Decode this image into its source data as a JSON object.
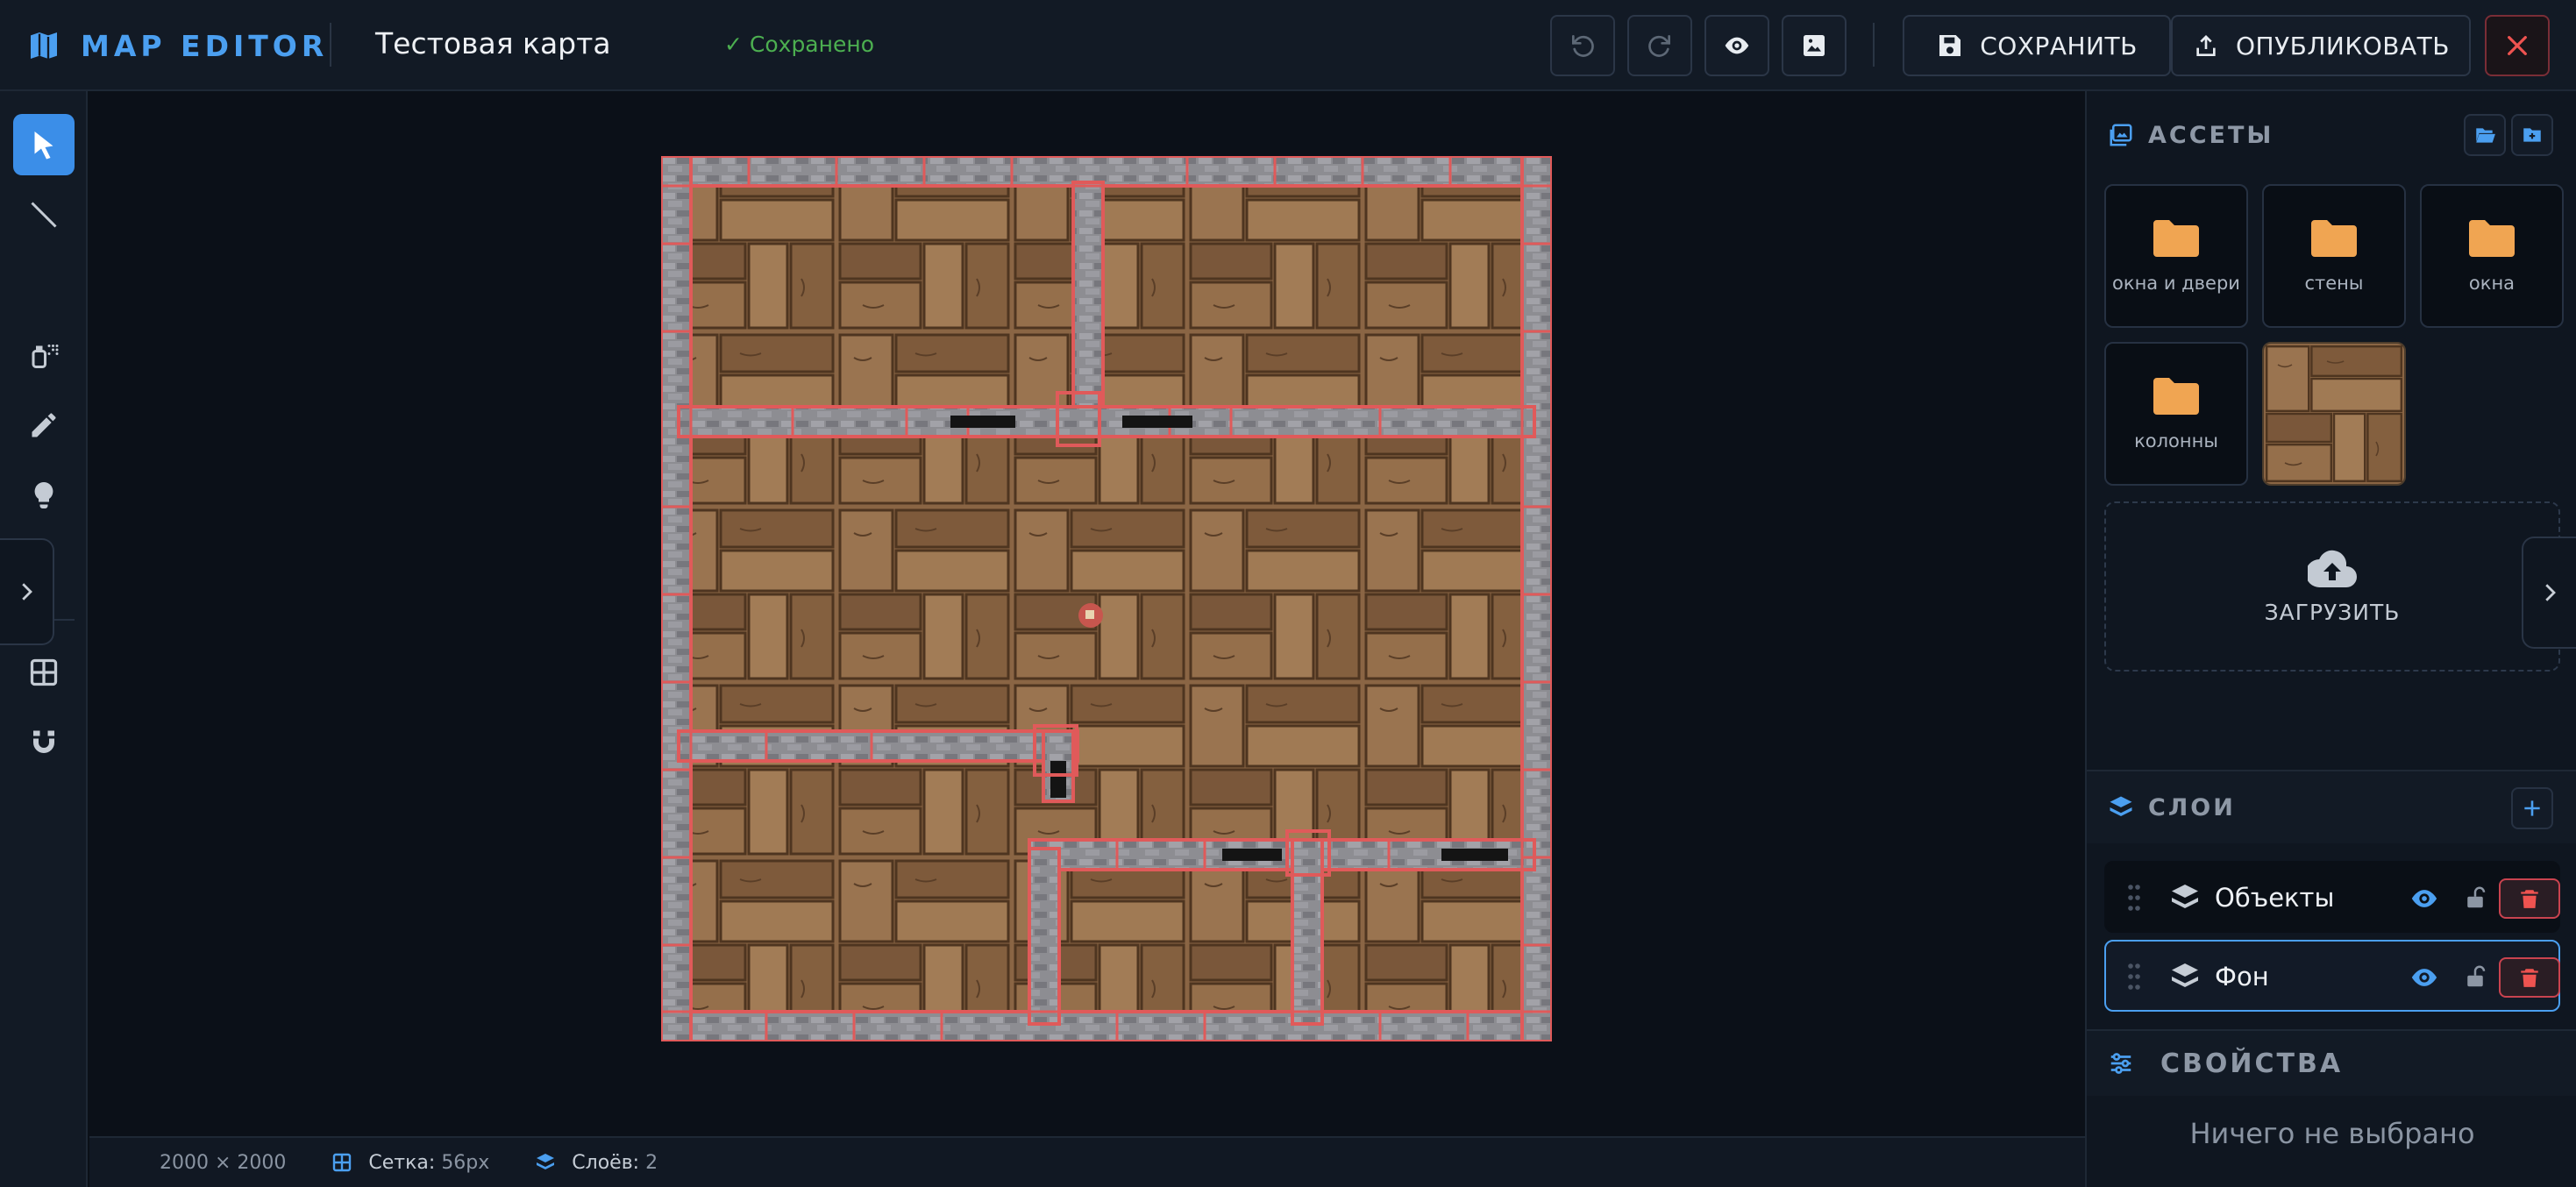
{
  "app": {
    "brand": "MAP EDITOR",
    "map_title": "Тестовая карта",
    "save_status": "✓ Сохранено"
  },
  "toolbar": {
    "save_label": "СОХРАНИТЬ",
    "publish_label": "ОПУБЛИКОВАТЬ"
  },
  "assets": {
    "title": "АССЕТЫ",
    "folders": [
      {
        "label": "окна и двери"
      },
      {
        "label": "стены"
      },
      {
        "label": "окна"
      },
      {
        "label": "колонны"
      }
    ],
    "upload_label": "ЗАГРУЗИТЬ"
  },
  "layers": {
    "title": "СЛОИ",
    "items": [
      {
        "name": "Объекты",
        "selected": false
      },
      {
        "name": "Фон",
        "selected": true
      }
    ]
  },
  "properties": {
    "title": "СВОЙСТВА",
    "empty_text": "Ничего не выбрано"
  },
  "status": {
    "size": "2000 × 2000",
    "grid_label": "Сетка:",
    "grid_value": "56px",
    "layers_label": "Слоёв:",
    "layers_value": "2"
  },
  "colors": {
    "accent": "#4b9ff0",
    "danger": "#ef5350",
    "saved": "#4caf50",
    "folder": "#f0a552",
    "wall_outline": "#e05a5a"
  },
  "icons": {
    "brand": "map-icon",
    "undo": "undo-icon",
    "redo": "redo-icon",
    "preview": "eye-icon",
    "image": "image-icon",
    "save": "floppy-disk-icon",
    "publish": "upload-icon",
    "close": "close-icon"
  }
}
